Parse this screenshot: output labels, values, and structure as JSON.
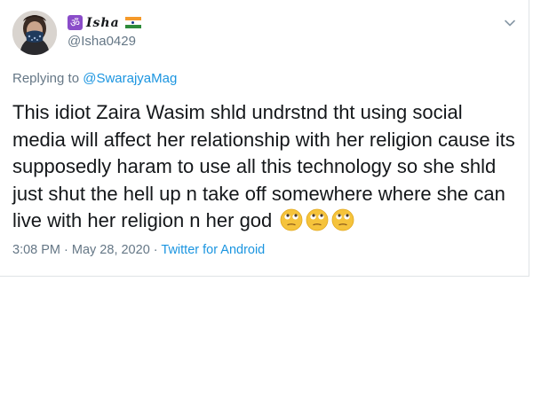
{
  "author": {
    "display_name": "Isha",
    "handle": "@Isha0429",
    "badge_icon": "om-icon",
    "flag_icon": "india-flag-icon"
  },
  "reply": {
    "prefix": "Replying to ",
    "to_handle": "@SwarajyaMag"
  },
  "tweet": {
    "text": "This idiot Zaira Wasim shld undrstnd tht using social media will affect her relationship with her religion cause its supposedly haram to use all this technology so she shld just shut the hell up n take off somewhere where she can live with her religion n her god",
    "emojis": [
      "face-with-rolling-eyes",
      "face-with-rolling-eyes",
      "face-with-rolling-eyes"
    ]
  },
  "meta": {
    "time": "3:08 PM",
    "separator": " · ",
    "date": "May 28, 2020",
    "source": "Twitter for Android"
  },
  "colors": {
    "link": "#1b95e0",
    "secondary_text": "#657786",
    "primary_text": "#14171a"
  }
}
